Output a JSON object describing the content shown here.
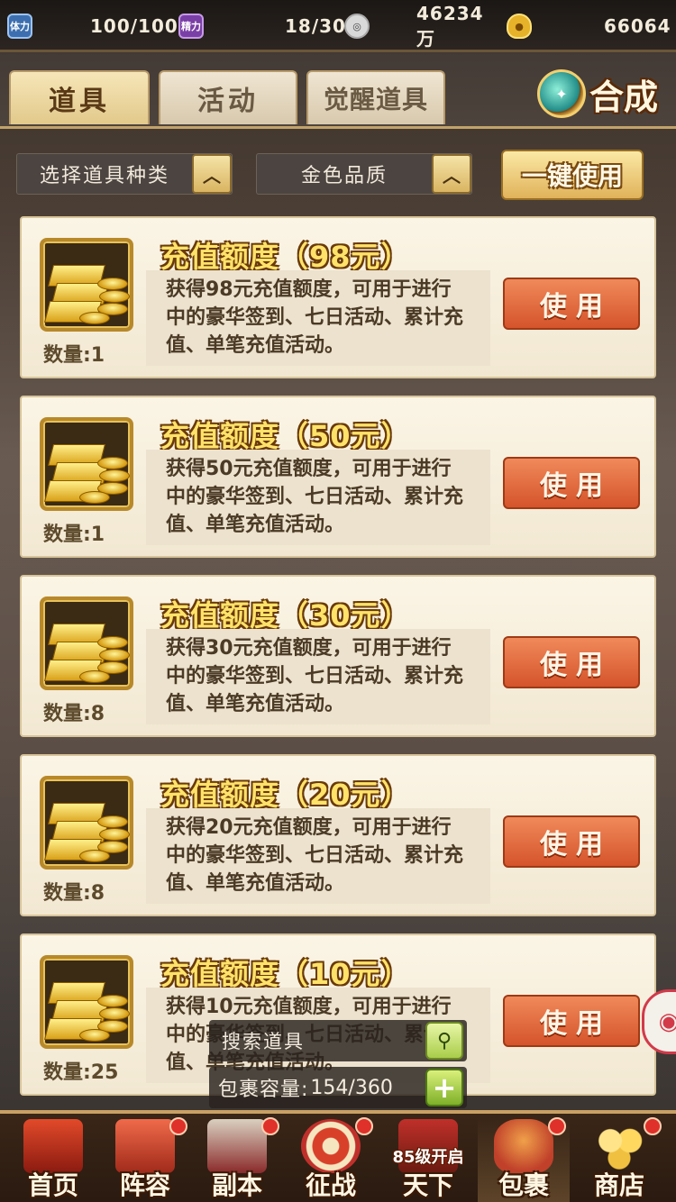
{
  "resources": {
    "stamina": {
      "icon": "体力",
      "value": "100/100"
    },
    "energy": {
      "icon": "精力",
      "value": "18/30"
    },
    "coins": {
      "value": "46234万"
    },
    "gold": {
      "value": "66064"
    }
  },
  "tabs": [
    {
      "label": "道具"
    },
    {
      "label": "活动"
    },
    {
      "label": "觉醒道具"
    }
  ],
  "synthesize_label": "合成",
  "filters": {
    "type_label": "选择道具种类",
    "quality_label": "金色品质",
    "use_all_label": "一键使用"
  },
  "items": [
    {
      "title": "充值额度（98元）",
      "desc": "获得98元充值额度，可用于进行中的豪华签到、七日活动、累计充值、单笔充值活动。",
      "qty": "数量:1",
      "use": "使用"
    },
    {
      "title": "充值额度（50元）",
      "desc": "获得50元充值额度，可用于进行中的豪华签到、七日活动、累计充值、单笔充值活动。",
      "qty": "数量:1",
      "use": "使用"
    },
    {
      "title": "充值额度（30元）",
      "desc": "获得30元充值额度，可用于进行中的豪华签到、七日活动、累计充值、单笔充值活动。",
      "qty": "数量:8",
      "use": "使用"
    },
    {
      "title": "充值额度（20元）",
      "desc": "获得20元充值额度，可用于进行中的豪华签到、七日活动、累计充值、单笔充值活动。",
      "qty": "数量:8",
      "use": "使用"
    },
    {
      "title": "充值额度（10元）",
      "desc": "获得10元充值额度，可用于进行中的豪华签到、七日活动、累计充值、单笔充值活动。",
      "qty": "数量:25",
      "use": "使用"
    }
  ],
  "search": {
    "label": "搜索道具"
  },
  "capacity": {
    "label": "包裹容量:",
    "value": "154/360"
  },
  "nav": [
    {
      "label": "首页",
      "color": "#c0392b",
      "dot": false
    },
    {
      "label": "阵容",
      "color": "#b83a2a",
      "dot": true
    },
    {
      "label": "副本",
      "color": "#8a2a2a",
      "dot": true
    },
    {
      "label": "征战",
      "color": "#c03a2a",
      "dot": true
    },
    {
      "label": "天下",
      "color": "#a03020",
      "dot": true,
      "badge": "85级开启"
    },
    {
      "label": "包裹",
      "color": "#c8482a",
      "dot": true
    },
    {
      "label": "商店",
      "color": "#c89a2a",
      "dot": true
    }
  ]
}
